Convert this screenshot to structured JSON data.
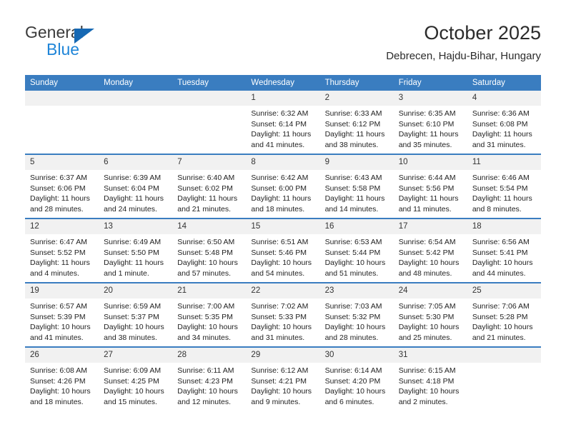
{
  "brand": {
    "name_part1": "General",
    "name_part2": "Blue",
    "triangle_color": "#1668b3",
    "blue_color": "#1f85d8"
  },
  "header": {
    "title": "October 2025",
    "subtitle": "Debrecen, Hajdu-Bihar, Hungary"
  },
  "theme": {
    "header_blue": "#3a7dc0",
    "daynum_gray": "#f1f1f1"
  },
  "calendar": {
    "weekday_headers": [
      "Sunday",
      "Monday",
      "Tuesday",
      "Wednesday",
      "Thursday",
      "Friday",
      "Saturday"
    ],
    "weeks": [
      [
        {
          "day": "",
          "lines": []
        },
        {
          "day": "",
          "lines": []
        },
        {
          "day": "",
          "lines": []
        },
        {
          "day": "1",
          "lines": [
            "Sunrise: 6:32 AM",
            "Sunset: 6:14 PM",
            "Daylight: 11 hours",
            "and 41 minutes."
          ]
        },
        {
          "day": "2",
          "lines": [
            "Sunrise: 6:33 AM",
            "Sunset: 6:12 PM",
            "Daylight: 11 hours",
            "and 38 minutes."
          ]
        },
        {
          "day": "3",
          "lines": [
            "Sunrise: 6:35 AM",
            "Sunset: 6:10 PM",
            "Daylight: 11 hours",
            "and 35 minutes."
          ]
        },
        {
          "day": "4",
          "lines": [
            "Sunrise: 6:36 AM",
            "Sunset: 6:08 PM",
            "Daylight: 11 hours",
            "and 31 minutes."
          ]
        }
      ],
      [
        {
          "day": "5",
          "lines": [
            "Sunrise: 6:37 AM",
            "Sunset: 6:06 PM",
            "Daylight: 11 hours",
            "and 28 minutes."
          ]
        },
        {
          "day": "6",
          "lines": [
            "Sunrise: 6:39 AM",
            "Sunset: 6:04 PM",
            "Daylight: 11 hours",
            "and 24 minutes."
          ]
        },
        {
          "day": "7",
          "lines": [
            "Sunrise: 6:40 AM",
            "Sunset: 6:02 PM",
            "Daylight: 11 hours",
            "and 21 minutes."
          ]
        },
        {
          "day": "8",
          "lines": [
            "Sunrise: 6:42 AM",
            "Sunset: 6:00 PM",
            "Daylight: 11 hours",
            "and 18 minutes."
          ]
        },
        {
          "day": "9",
          "lines": [
            "Sunrise: 6:43 AM",
            "Sunset: 5:58 PM",
            "Daylight: 11 hours",
            "and 14 minutes."
          ]
        },
        {
          "day": "10",
          "lines": [
            "Sunrise: 6:44 AM",
            "Sunset: 5:56 PM",
            "Daylight: 11 hours",
            "and 11 minutes."
          ]
        },
        {
          "day": "11",
          "lines": [
            "Sunrise: 6:46 AM",
            "Sunset: 5:54 PM",
            "Daylight: 11 hours",
            "and 8 minutes."
          ]
        }
      ],
      [
        {
          "day": "12",
          "lines": [
            "Sunrise: 6:47 AM",
            "Sunset: 5:52 PM",
            "Daylight: 11 hours",
            "and 4 minutes."
          ]
        },
        {
          "day": "13",
          "lines": [
            "Sunrise: 6:49 AM",
            "Sunset: 5:50 PM",
            "Daylight: 11 hours",
            "and 1 minute."
          ]
        },
        {
          "day": "14",
          "lines": [
            "Sunrise: 6:50 AM",
            "Sunset: 5:48 PM",
            "Daylight: 10 hours",
            "and 57 minutes."
          ]
        },
        {
          "day": "15",
          "lines": [
            "Sunrise: 6:51 AM",
            "Sunset: 5:46 PM",
            "Daylight: 10 hours",
            "and 54 minutes."
          ]
        },
        {
          "day": "16",
          "lines": [
            "Sunrise: 6:53 AM",
            "Sunset: 5:44 PM",
            "Daylight: 10 hours",
            "and 51 minutes."
          ]
        },
        {
          "day": "17",
          "lines": [
            "Sunrise: 6:54 AM",
            "Sunset: 5:42 PM",
            "Daylight: 10 hours",
            "and 48 minutes."
          ]
        },
        {
          "day": "18",
          "lines": [
            "Sunrise: 6:56 AM",
            "Sunset: 5:41 PM",
            "Daylight: 10 hours",
            "and 44 minutes."
          ]
        }
      ],
      [
        {
          "day": "19",
          "lines": [
            "Sunrise: 6:57 AM",
            "Sunset: 5:39 PM",
            "Daylight: 10 hours",
            "and 41 minutes."
          ]
        },
        {
          "day": "20",
          "lines": [
            "Sunrise: 6:59 AM",
            "Sunset: 5:37 PM",
            "Daylight: 10 hours",
            "and 38 minutes."
          ]
        },
        {
          "day": "21",
          "lines": [
            "Sunrise: 7:00 AM",
            "Sunset: 5:35 PM",
            "Daylight: 10 hours",
            "and 34 minutes."
          ]
        },
        {
          "day": "22",
          "lines": [
            "Sunrise: 7:02 AM",
            "Sunset: 5:33 PM",
            "Daylight: 10 hours",
            "and 31 minutes."
          ]
        },
        {
          "day": "23",
          "lines": [
            "Sunrise: 7:03 AM",
            "Sunset: 5:32 PM",
            "Daylight: 10 hours",
            "and 28 minutes."
          ]
        },
        {
          "day": "24",
          "lines": [
            "Sunrise: 7:05 AM",
            "Sunset: 5:30 PM",
            "Daylight: 10 hours",
            "and 25 minutes."
          ]
        },
        {
          "day": "25",
          "lines": [
            "Sunrise: 7:06 AM",
            "Sunset: 5:28 PM",
            "Daylight: 10 hours",
            "and 21 minutes."
          ]
        }
      ],
      [
        {
          "day": "26",
          "lines": [
            "Sunrise: 6:08 AM",
            "Sunset: 4:26 PM",
            "Daylight: 10 hours",
            "and 18 minutes."
          ]
        },
        {
          "day": "27",
          "lines": [
            "Sunrise: 6:09 AM",
            "Sunset: 4:25 PM",
            "Daylight: 10 hours",
            "and 15 minutes."
          ]
        },
        {
          "day": "28",
          "lines": [
            "Sunrise: 6:11 AM",
            "Sunset: 4:23 PM",
            "Daylight: 10 hours",
            "and 12 minutes."
          ]
        },
        {
          "day": "29",
          "lines": [
            "Sunrise: 6:12 AM",
            "Sunset: 4:21 PM",
            "Daylight: 10 hours",
            "and 9 minutes."
          ]
        },
        {
          "day": "30",
          "lines": [
            "Sunrise: 6:14 AM",
            "Sunset: 4:20 PM",
            "Daylight: 10 hours",
            "and 6 minutes."
          ]
        },
        {
          "day": "31",
          "lines": [
            "Sunrise: 6:15 AM",
            "Sunset: 4:18 PM",
            "Daylight: 10 hours",
            "and 2 minutes."
          ]
        },
        {
          "day": "",
          "lines": []
        }
      ]
    ]
  }
}
